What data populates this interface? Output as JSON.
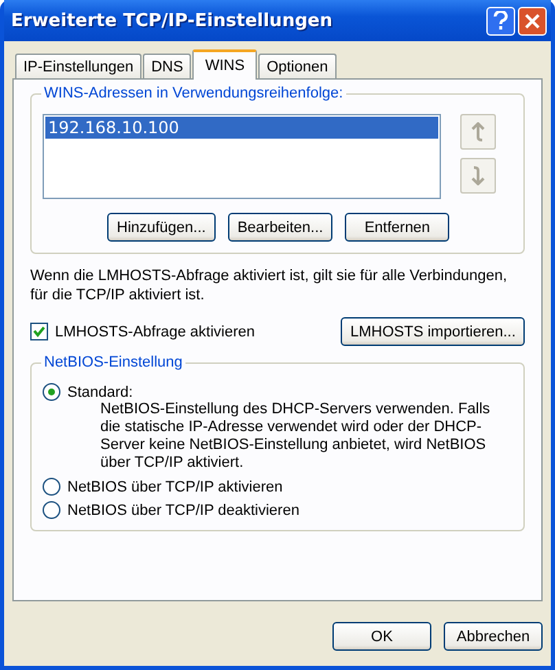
{
  "window": {
    "title": "Erweiterte TCP/IP-Einstellungen"
  },
  "tabs": [
    {
      "label": "IP-Einstellungen",
      "selected": false
    },
    {
      "label": "DNS",
      "selected": false
    },
    {
      "label": "WINS",
      "selected": true
    },
    {
      "label": "Optionen",
      "selected": false
    }
  ],
  "wins_group": {
    "title": "WINS-Adressen in Verwendungsreihenfolge:",
    "addresses": [
      {
        "label": "192.168.10.100",
        "selected": true
      }
    ],
    "buttons": [
      "Hinzufügen...",
      "Bearbeiten...",
      "Entfernen"
    ]
  },
  "lmhosts": {
    "description": "Wenn die LMHOSTS-Abfrage aktiviert ist, gilt sie für alle Verbindungen, für die TCP/IP aktiviert ist.",
    "checkbox": {
      "label": "LMHOSTS-Abfrage aktivieren",
      "checked": true
    },
    "import_button": "LMHOSTS importieren..."
  },
  "netbios_group": {
    "title": "NetBIOS-Einstellung",
    "options": [
      {
        "label": "Standard:",
        "description": "NetBIOS-Einstellung des DHCP-Servers verwenden. Falls die statische IP-Adresse verwendet wird oder der DHCP-Server keine NetBIOS-Einstellung anbietet, wird NetBIOS über TCP/IP aktiviert.",
        "selected": true
      },
      {
        "label": "NetBIOS über TCP/IP aktivieren",
        "selected": false
      },
      {
        "label": "NetBIOS über TCP/IP deaktivieren",
        "selected": false
      }
    ]
  },
  "buttons": [
    "OK",
    "Abbrechen"
  ]
}
